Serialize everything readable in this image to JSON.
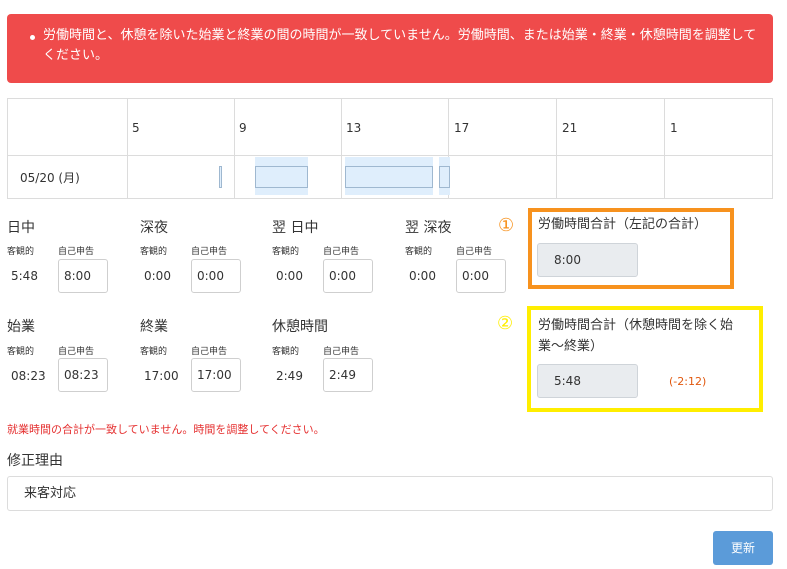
{
  "alert": {
    "message": "労働時間と、休憩を除いた始業と終業の間の時間が一致していません。労働時間、または始業・終業・休憩時間を調整してください。"
  },
  "timeline": {
    "ticks": [
      "5",
      "9",
      "13",
      "17",
      "21",
      "1"
    ],
    "date": "05/20 (月)"
  },
  "groups": {
    "daytime": {
      "label": "日中",
      "objective_label": "客観的",
      "self_label": "自己申告",
      "objective_value": "5:48",
      "self_value": "8:00"
    },
    "late_night": {
      "label": "深夜",
      "objective_label": "客観的",
      "self_label": "自己申告",
      "objective_value": "0:00",
      "self_value": "0:00"
    },
    "next_day_daytime": {
      "label": "翌 日中",
      "objective_label": "客観的",
      "self_label": "自己申告",
      "objective_value": "0:00",
      "self_value": "0:00"
    },
    "next_day_late_night": {
      "label": "翌 深夜",
      "objective_label": "客観的",
      "self_label": "自己申告",
      "objective_value": "0:00",
      "self_value": "0:00"
    },
    "start": {
      "label": "始業",
      "objective_label": "客観的",
      "self_label": "自己申告",
      "objective_value": "08:23",
      "self_value": "08:23"
    },
    "end": {
      "label": "終業",
      "objective_label": "客観的",
      "self_label": "自己申告",
      "objective_value": "17:00",
      "self_value": "17:00"
    },
    "break": {
      "label": "休憩時間",
      "objective_label": "客観的",
      "self_label": "自己申告",
      "objective_value": "2:49",
      "self_value": "2:49"
    }
  },
  "totals": {
    "sum": {
      "marker": "①",
      "title": "労働時間合計（左記の合計）",
      "value": "8:00"
    },
    "span": {
      "marker": "②",
      "title": "労働時間合計（休憩時間を除く始業〜終業）",
      "value": "5:48",
      "diff": "(-2:12)"
    }
  },
  "error": "就業時間の合計が一致していません。時間を調整してください。",
  "reason": {
    "label": "修正理由",
    "value": "来客対応"
  },
  "update_button": "更新",
  "colors": {
    "alert_bg": "#ef4b4b",
    "marker_1": "#f7921e",
    "marker_2": "#ffee00",
    "error_text": "#e53030",
    "diff_text": "#e1580e",
    "button_bg": "#5b9bd9"
  }
}
